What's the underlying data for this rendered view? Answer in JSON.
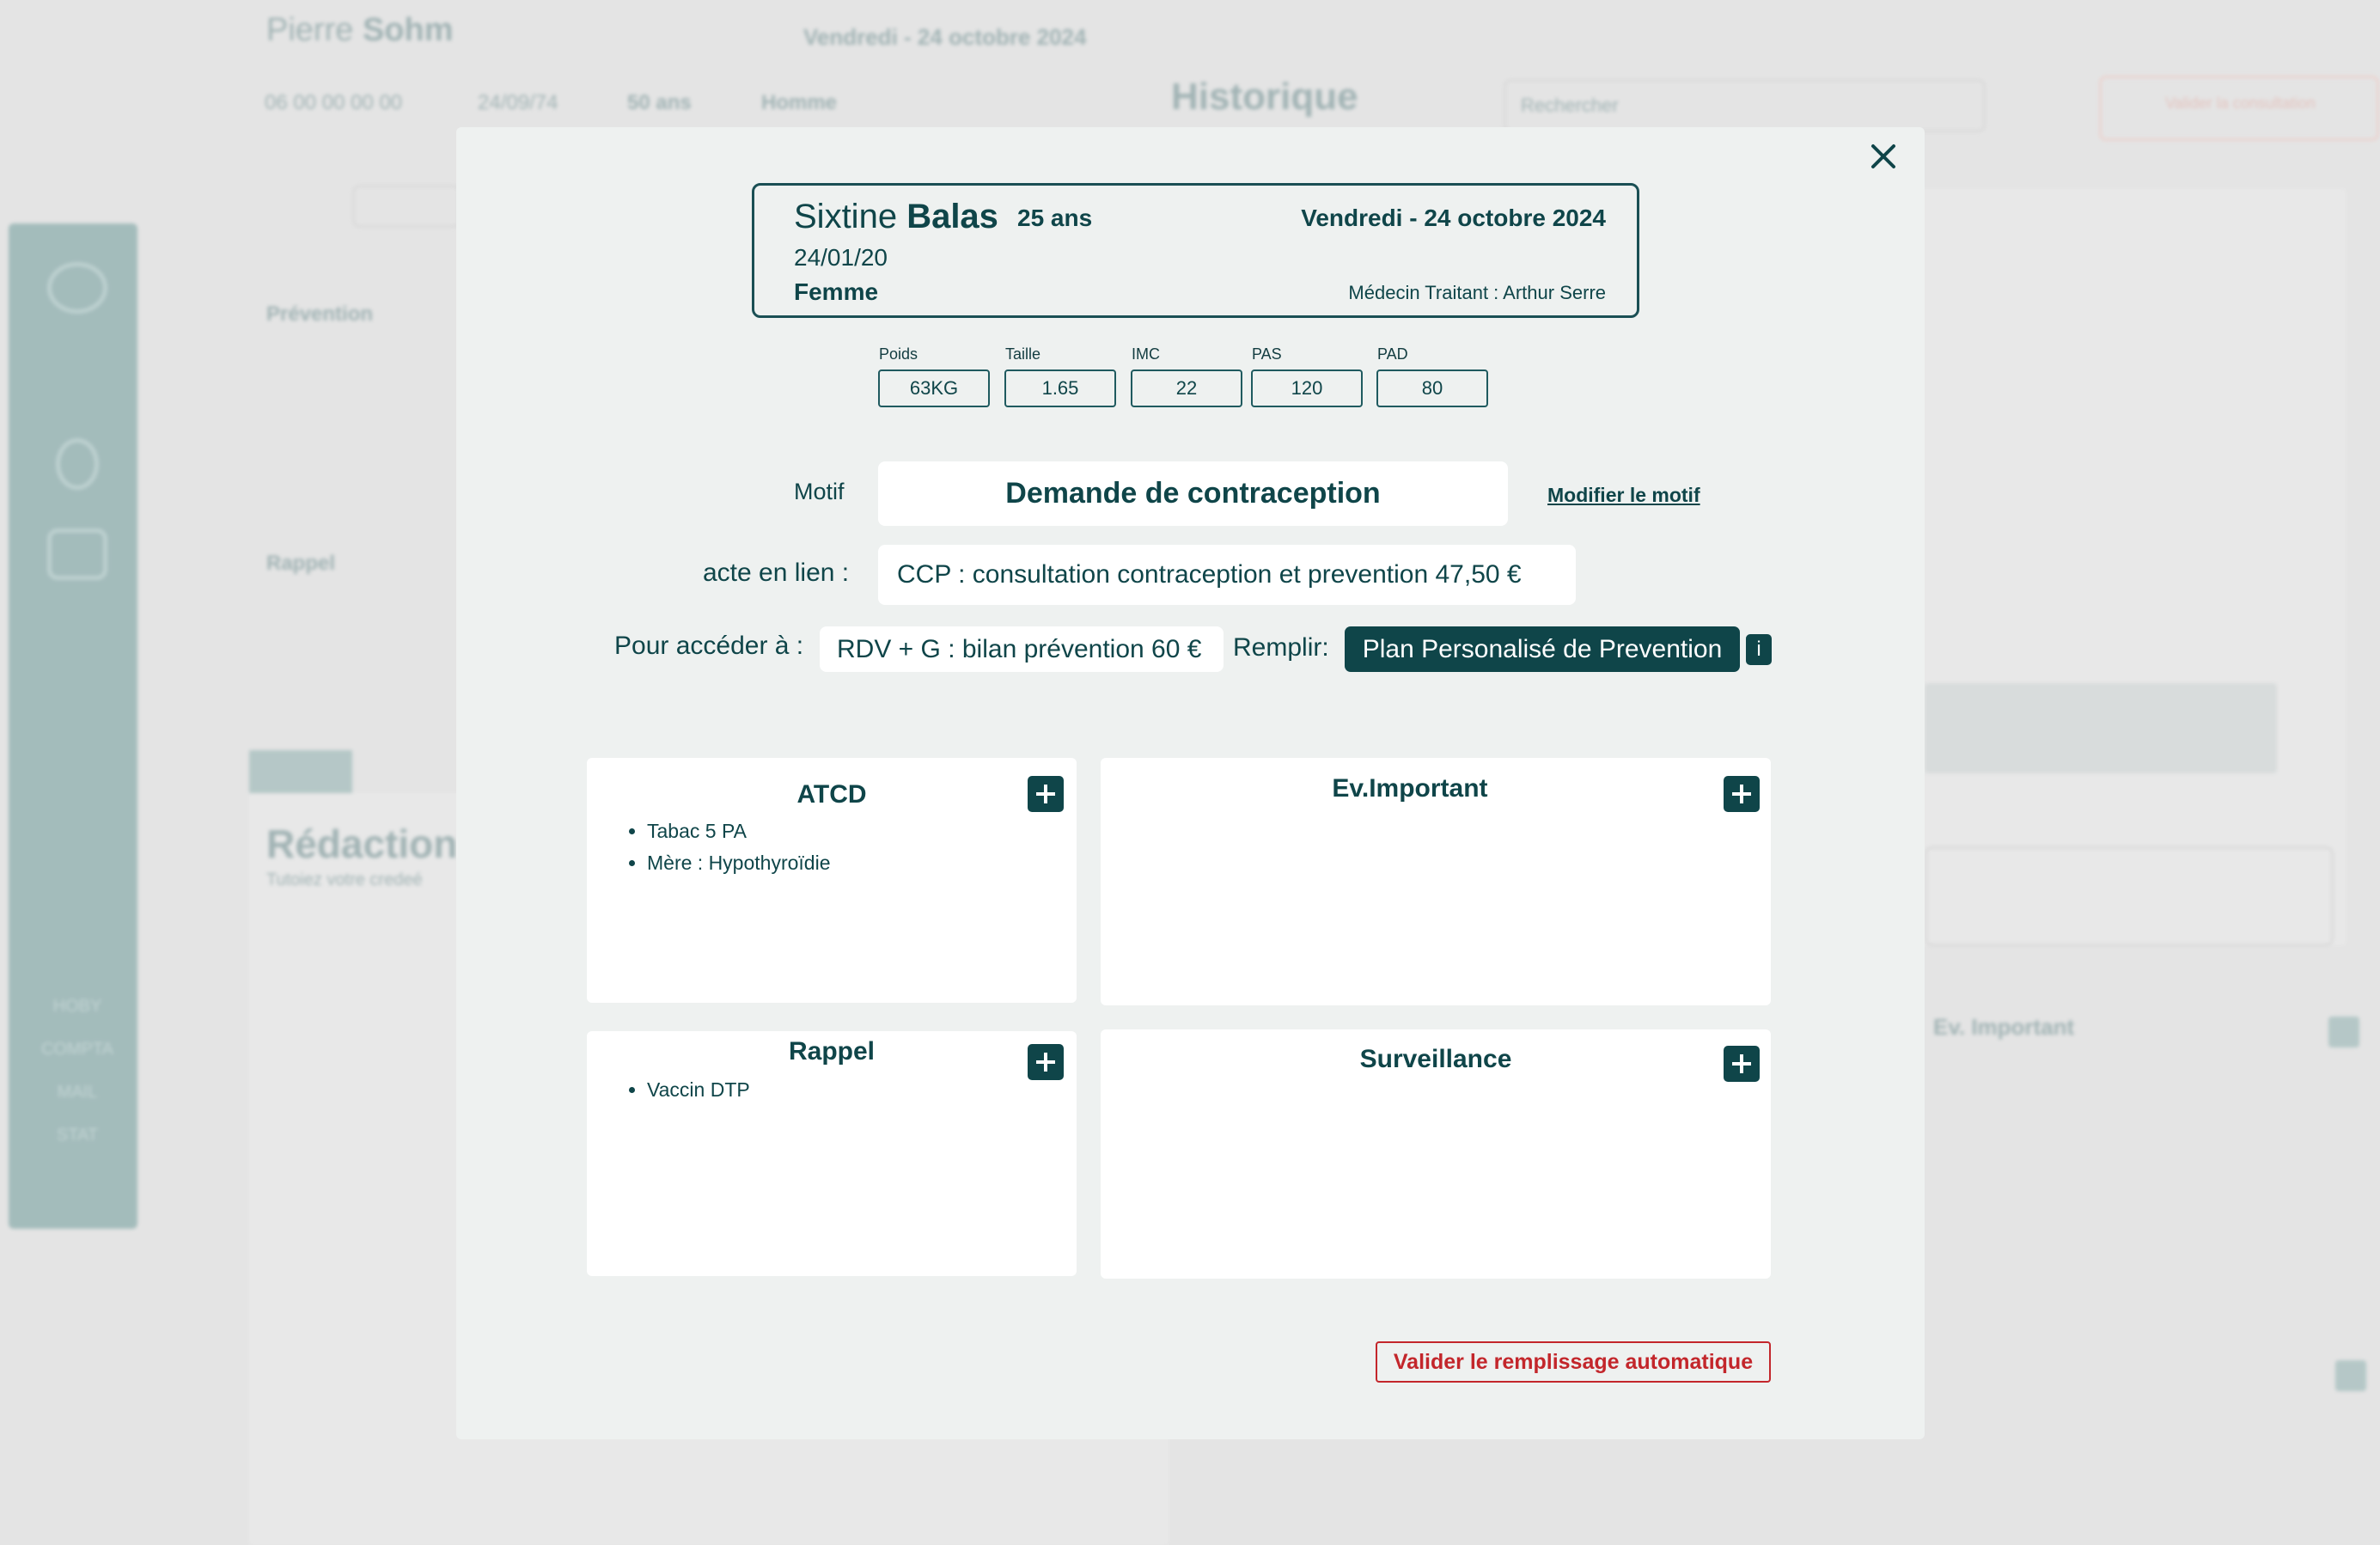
{
  "background": {
    "patient_first": "Pierre",
    "patient_last": "Sohm",
    "date": "Vendredi - 24 octobre 2024",
    "phone": "06 00 00 00 00",
    "dob": "24/09/74",
    "age": "50 ans",
    "sex": "Homme",
    "historique": "Historique",
    "search_placeholder": "Rechercher",
    "action_button": "Valider la consultation",
    "prevention": "Prévention",
    "rappel": "Rappel",
    "redaction": "Rédaction",
    "redaction_sub": "Tutoiez votre credeé",
    "ev_important": "Ev. Important",
    "sidebar_labels": [
      "HOBY",
      "COMPTA",
      "MAIL",
      "STAT"
    ]
  },
  "modal": {
    "patient": {
      "first_name": "Sixtine",
      "last_name": "Balas",
      "age": "25 ans",
      "dob": "24/01/20",
      "sex": "Femme",
      "date": "Vendredi - 24 octobre 2024",
      "doctor": "Médecin Traitant : Arthur Serre"
    },
    "vitals": [
      {
        "label": "Poids",
        "value": "63KG"
      },
      {
        "label": "Taille",
        "value": "1.65"
      },
      {
        "label": "IMC",
        "value": "22"
      },
      {
        "label": "PAS",
        "value": "120"
      },
      {
        "label": "PAD",
        "value": "80"
      }
    ],
    "motif_label": "Motif",
    "motif_value": "Demande de contraception",
    "modify_motif": "Modifier le motif",
    "acte_label": "acte en lien :",
    "acte_value": "CCP : consultation contraception et prevention 47,50 €",
    "acceder_label": "Pour accéder à :",
    "acceder_value": "RDV + G : bilan prévention 60 €",
    "remplir_label": "Remplir:",
    "remplir_button": "Plan Personalisé de Prevention",
    "info_button": "i",
    "cards": {
      "atcd": {
        "title": "ATCD",
        "items": [
          "Tabac 5 PA",
          "Mère : Hypothyroïdie"
        ]
      },
      "ev_important": {
        "title": "Ev.Important",
        "items": []
      },
      "rappel": {
        "title": "Rappel",
        "items": [
          "Vaccin DTP"
        ]
      },
      "surveillance": {
        "title": "Surveillance",
        "items": []
      }
    },
    "validate_button": "Valider le remplissage automatique"
  }
}
